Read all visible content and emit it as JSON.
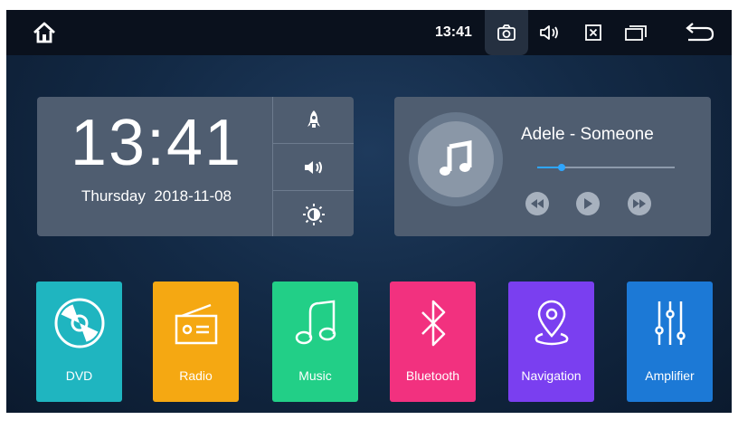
{
  "status_bar": {
    "time": "13:41",
    "icons": [
      "home-icon",
      "camera-icon",
      "volume-icon",
      "close-window-icon",
      "recent-apps-icon",
      "back-icon"
    ]
  },
  "clock_widget": {
    "time": "13:41",
    "day": "Thursday",
    "date": "2018-11-08",
    "side_buttons": [
      "rocket-icon",
      "volume-icon",
      "brightness-icon"
    ]
  },
  "music_widget": {
    "song_title": "Adele - Someone",
    "progress": 0.18,
    "controls": [
      "rewind-icon",
      "play-icon",
      "fast-forward-icon"
    ]
  },
  "apps": [
    {
      "label": "DVD",
      "color": "#1fb5c0",
      "icon": "disc-icon"
    },
    {
      "label": "Radio",
      "color": "#f5a812",
      "icon": "radio-icon"
    },
    {
      "label": "Music",
      "color": "#22cf87",
      "icon": "music-note-icon"
    },
    {
      "label": "Bluetooth",
      "color": "#f2317f",
      "icon": "bluetooth-icon"
    },
    {
      "label": "Navigation",
      "color": "#7a3ff0",
      "icon": "location-pin-icon"
    },
    {
      "label": "Amplifier",
      "color": "#1c79d6",
      "icon": "equalizer-icon"
    }
  ],
  "colors": {
    "progress_accent": "#2fa6ff",
    "card_bg": "#4f5d70",
    "status_bar_bg": "#0a111d"
  }
}
